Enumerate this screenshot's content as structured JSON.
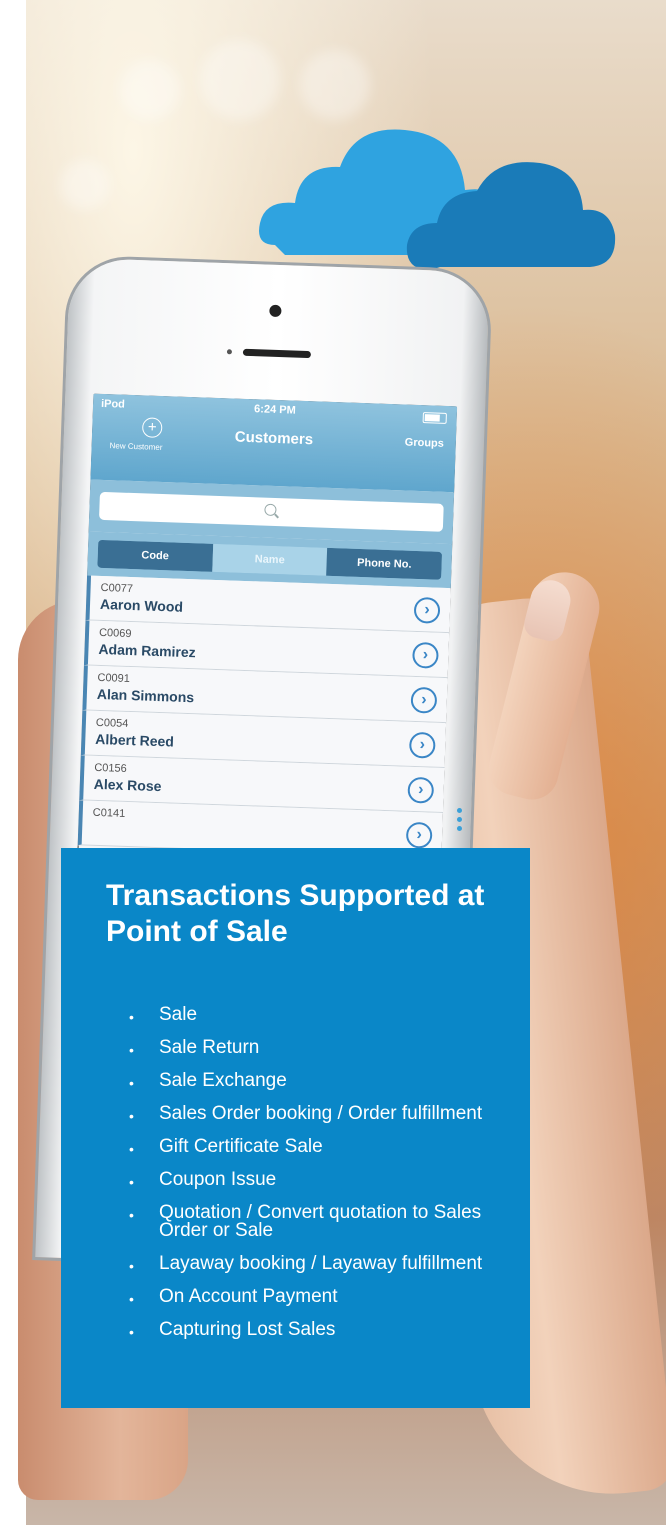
{
  "phone_app": {
    "status": {
      "carrier": "iPod",
      "time": "6:24 PM"
    },
    "navbar": {
      "new_customer_label": "New Customer",
      "title": "Customers",
      "groups_label": "Groups"
    },
    "search": {
      "placeholder": ""
    },
    "segments": [
      "Code",
      "Name",
      "Phone No."
    ],
    "selected_segment": "Name",
    "customers": [
      {
        "code": "C0077",
        "name": "Aaron Wood"
      },
      {
        "code": "C0069",
        "name": "Adam Ramirez"
      },
      {
        "code": "C0091",
        "name": "Alan Simmons"
      },
      {
        "code": "C0054",
        "name": "Albert Reed"
      },
      {
        "code": "C0156",
        "name": "Alex Rose"
      },
      {
        "code": "C0141",
        "name": ""
      }
    ]
  },
  "card": {
    "title": "Transactions Supported at Point of Sale",
    "items": [
      "Sale",
      "Sale Return",
      "Sale Exchange",
      "Sales Order booking / Order fulfillment",
      "Gift Certificate Sale",
      "Coupon Issue",
      "Quotation / Convert quotation to Sales Order or Sale",
      "Layaway booking / Layaway fulfillment",
      "On Account Payment",
      "Capturing Lost Sales"
    ]
  },
  "colors": {
    "card_bg": "#0a87c8",
    "cloud_light": "#2fa3e0",
    "cloud_dark": "#1a7bb8",
    "nav_blue": "#5fa6cd"
  }
}
